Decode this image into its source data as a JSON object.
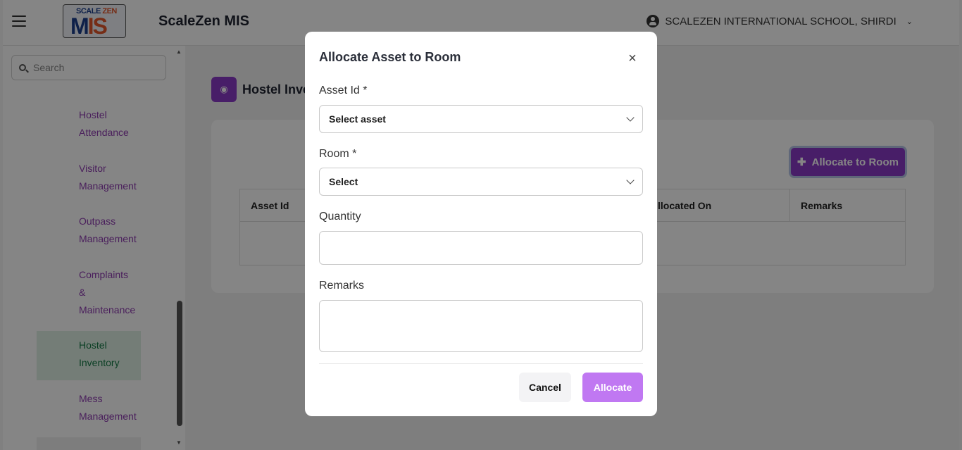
{
  "header": {
    "app_title": "ScaleZen MIS",
    "logo_top": "SCALE",
    "logo_top_accent": "ZEN",
    "logo_main": "M",
    "logo_main_accent": "IS",
    "school_name": "SCALEZEN INTERNATIONAL SCHOOL, SHIRDI"
  },
  "sidebar": {
    "search_placeholder": "Search",
    "items": [
      {
        "lines": [
          "Hostel",
          "Attendance"
        ]
      },
      {
        "lines": [
          "Visitor",
          "Management"
        ]
      },
      {
        "lines": [
          "Outpass",
          "Management"
        ]
      },
      {
        "lines": [
          "Complaints",
          "&",
          "Maintenance"
        ]
      },
      {
        "lines": [
          "Hostel",
          "Inventory"
        ],
        "active": true
      },
      {
        "lines": [
          "Mess",
          "Management"
        ]
      }
    ]
  },
  "main": {
    "page_title": "Hostel Inve",
    "allocate_button": "Allocate to Room",
    "table_headers": [
      "Asset Id",
      "llocated On",
      "Remarks"
    ]
  },
  "modal": {
    "title": "Allocate Asset to Room",
    "asset_label": "Asset Id *",
    "asset_value": "Select asset",
    "room_label": "Room *",
    "room_value": "Select",
    "quantity_label": "Quantity",
    "quantity_value": "",
    "remarks_label": "Remarks",
    "remarks_value": "",
    "cancel_label": "Cancel",
    "allocate_label": "Allocate"
  },
  "colors": {
    "accent": "#8b3ac7",
    "allocate_button": "#c078f2",
    "nav_text": "#8e3cb0",
    "nav_active_bg": "#dff0e4",
    "nav_active_text": "#157a45"
  }
}
